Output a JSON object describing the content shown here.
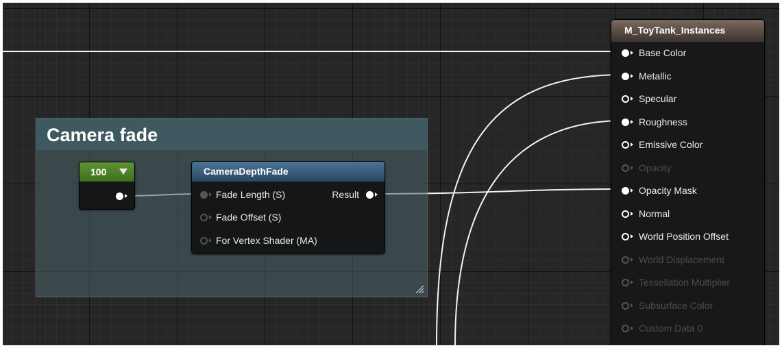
{
  "comment": {
    "title": "Camera fade"
  },
  "constant_node": {
    "value": "100"
  },
  "camera_depth_fade": {
    "title": "CameraDepthFade",
    "inputs": [
      {
        "label": "Fade Length (S)",
        "connected": true
      },
      {
        "label": "Fade Offset (S)",
        "connected": false
      },
      {
        "label": "For Vertex Shader (MA)",
        "connected": false
      }
    ],
    "output": {
      "label": "Result"
    }
  },
  "material_node": {
    "title": "M_ToyTank_Instances",
    "inputs": [
      {
        "label": "Base Color",
        "state": "connected"
      },
      {
        "label": "Metallic",
        "state": "connected"
      },
      {
        "label": "Specular",
        "state": "available"
      },
      {
        "label": "Roughness",
        "state": "connected"
      },
      {
        "label": "Emissive Color",
        "state": "available"
      },
      {
        "label": "Opacity",
        "state": "disabled"
      },
      {
        "label": "Opacity Mask",
        "state": "connected"
      },
      {
        "label": "Normal",
        "state": "available"
      },
      {
        "label": "World Position Offset",
        "state": "available"
      },
      {
        "label": "World Displacement",
        "state": "disabled"
      },
      {
        "label": "Tessellation Multiplier",
        "state": "disabled"
      },
      {
        "label": "Subsurface Color",
        "state": "disabled"
      },
      {
        "label": "Custom Data 0",
        "state": "disabled"
      }
    ]
  },
  "colors": {
    "graph_background": "#262626",
    "comment_box": "#4c646a",
    "constant_header": "#4f8a28",
    "function_header": "#3f6283",
    "material_header": "#5e4f46",
    "wire": "#ffffff"
  }
}
